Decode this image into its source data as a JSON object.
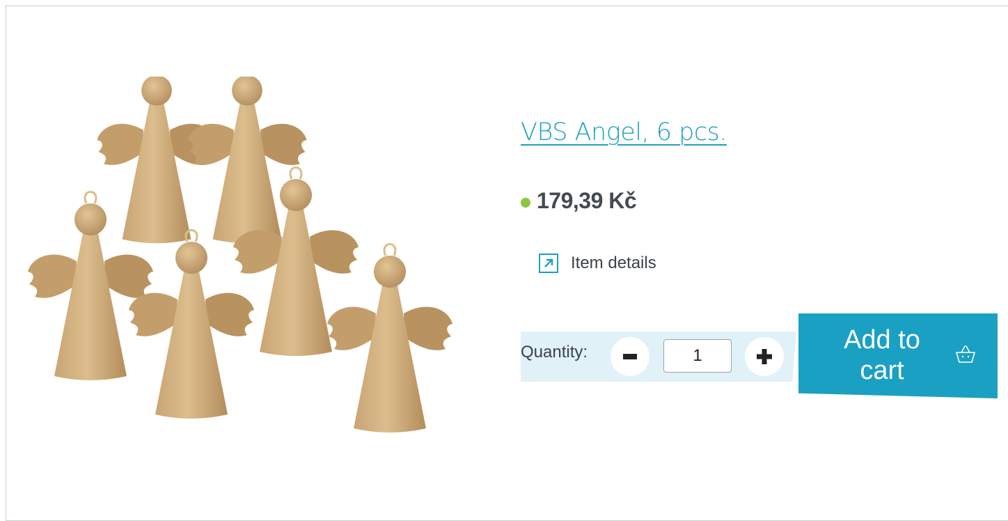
{
  "product": {
    "title": "VBS Angel, 6 pcs.",
    "price": "179,39 Kč",
    "stock_status_color": "#8dc63f",
    "image_alt": "six papier-mâché angel figures",
    "item_details_label": "Item details",
    "item_details_icon": "external-link-arrow-icon"
  },
  "quantity": {
    "label": "Quantity:",
    "value": "1",
    "decrement_icon": "minus-icon",
    "increment_icon": "plus-icon"
  },
  "cart": {
    "add_label": "Add to cart",
    "icon": "shopping-basket-icon"
  },
  "colors": {
    "accent": "#1aa0c2",
    "quantity_band": "#e1f1f8",
    "text": "#3c4248"
  }
}
